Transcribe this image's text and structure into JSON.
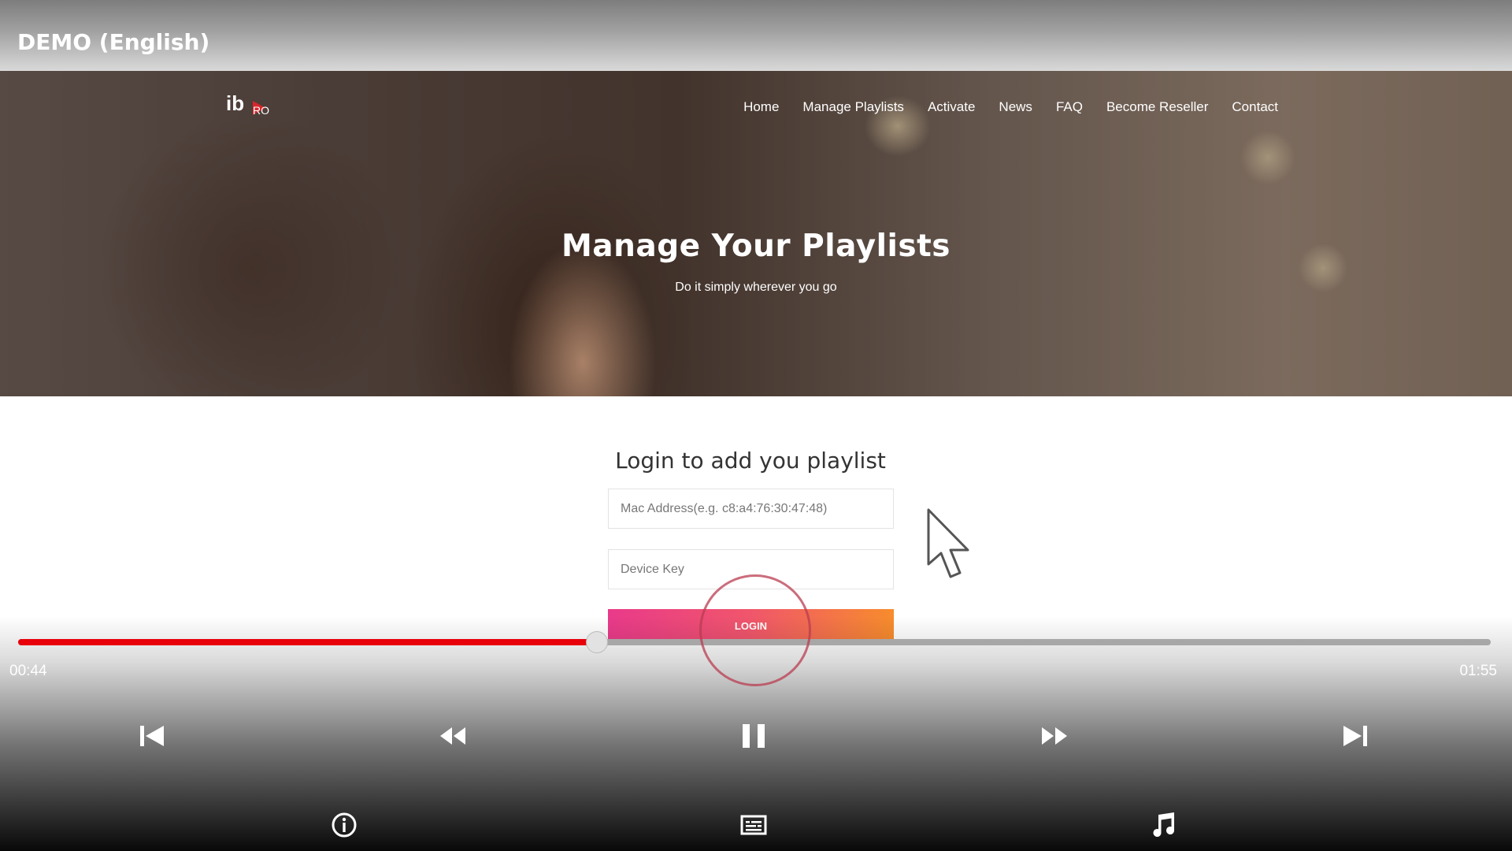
{
  "player": {
    "title": "DEMO (English)",
    "time_current": "00:44",
    "time_total": "01:55",
    "progress_fraction": 0.393,
    "accent_color": "#e8000b"
  },
  "site": {
    "logo_text": "ib",
    "logo_suffix": "RO",
    "nav": [
      "Home",
      "Manage Playlists",
      "Activate",
      "News",
      "FAQ",
      "Become Reseller",
      "Contact"
    ],
    "hero_title": "Manage Your Playlists",
    "hero_subtitle": "Do it simply wherever you go",
    "login_title": "Login to add you playlist",
    "mac_placeholder": "Mac Address(e.g. c8:a4:76:30:47:48)",
    "device_key_placeholder": "Device Key",
    "login_label": "LOGIN"
  },
  "controls": {
    "icons": [
      "skip-previous-icon",
      "rewind-icon",
      "pause-icon",
      "fast-forward-icon",
      "skip-next-icon",
      "info-icon",
      "subtitles-icon",
      "audio-track-icon"
    ]
  }
}
